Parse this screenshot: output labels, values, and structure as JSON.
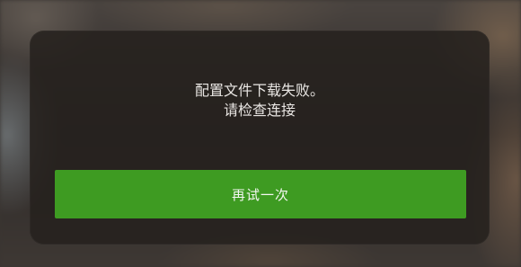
{
  "dialog": {
    "message_line1": "配置文件下载失败。",
    "message_line2": "请检查连接",
    "retry_label": "再试一次"
  },
  "colors": {
    "button": "#3e9b22",
    "dialog_bg": "#26211e",
    "text": "#e9e6e3"
  }
}
